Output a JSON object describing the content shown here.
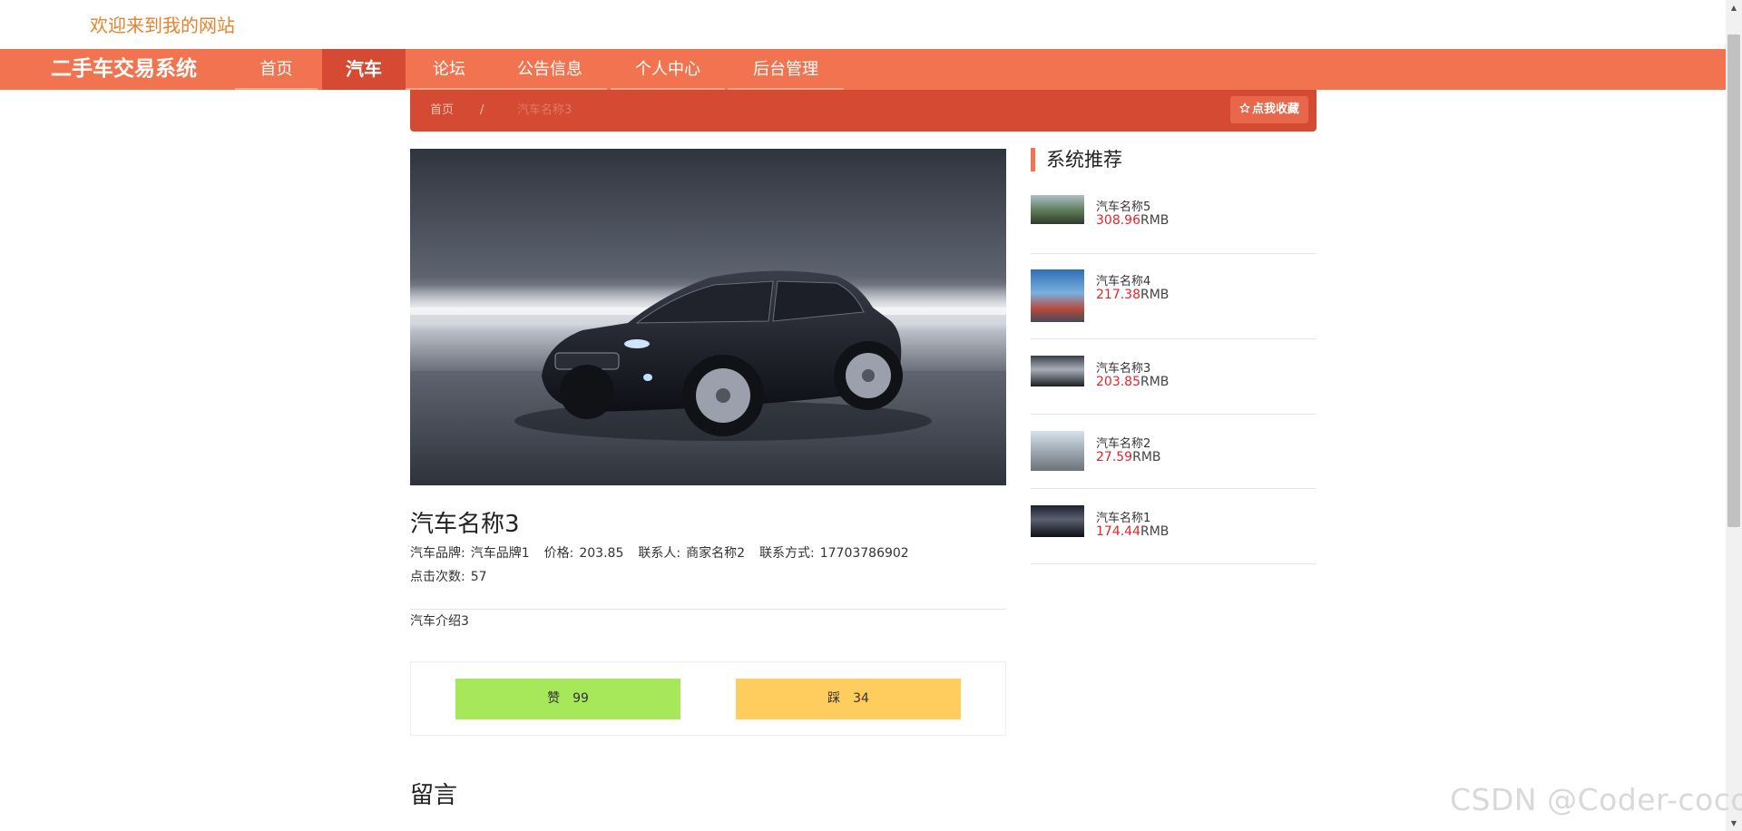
{
  "header": {
    "welcome": "欢迎来到我的网站"
  },
  "nav": {
    "brand": "二手车交易系统",
    "items": [
      {
        "label": "首页"
      },
      {
        "label": "汽车"
      },
      {
        "label": "论坛"
      },
      {
        "label": "公告信息"
      },
      {
        "label": "个人中心"
      },
      {
        "label": "后台管理"
      }
    ],
    "active": "汽车"
  },
  "breadcrumb": {
    "home": "首页",
    "separator": "/",
    "current": "汽车名称3",
    "favorite_label": "点我收藏",
    "favorite_icon": "star-outline-icon"
  },
  "detail": {
    "title": "汽车名称3",
    "brand_label": "汽车品牌:",
    "brand_value": "汽车品牌1",
    "price_label": "价格:",
    "price_value": "203.85",
    "contact_label": "联系人:",
    "contact_value": "商家名称2",
    "phone_label": "联系方式:",
    "phone_value": "17703786902",
    "clicks_label": "点击次数:",
    "clicks_value": "57",
    "intro": "汽车介绍3"
  },
  "votes": {
    "up_label": "赞",
    "up_count": "99",
    "down_label": "踩",
    "down_count": "34"
  },
  "comments": {
    "title": "留言"
  },
  "recommend": {
    "title": "系统推荐",
    "currency": "RMB",
    "items": [
      {
        "name": "汽车名称5",
        "price": "308.96"
      },
      {
        "name": "汽车名称4",
        "price": "217.38"
      },
      {
        "name": "汽车名称3",
        "price": "203.85"
      },
      {
        "name": "汽车名称2",
        "price": "27.59"
      },
      {
        "name": "汽车名称1",
        "price": "174.44"
      }
    ]
  },
  "watermark": "CSDN @Coder-coco",
  "colors": {
    "nav_bg": "#f2734f",
    "nav_active": "#d64a34",
    "breadcrumb_bg": "#d44a32",
    "price_red": "#e5242a",
    "vote_up": "#a6e85a",
    "vote_down": "#fecd5e",
    "welcome_orange": "#e8822c"
  }
}
